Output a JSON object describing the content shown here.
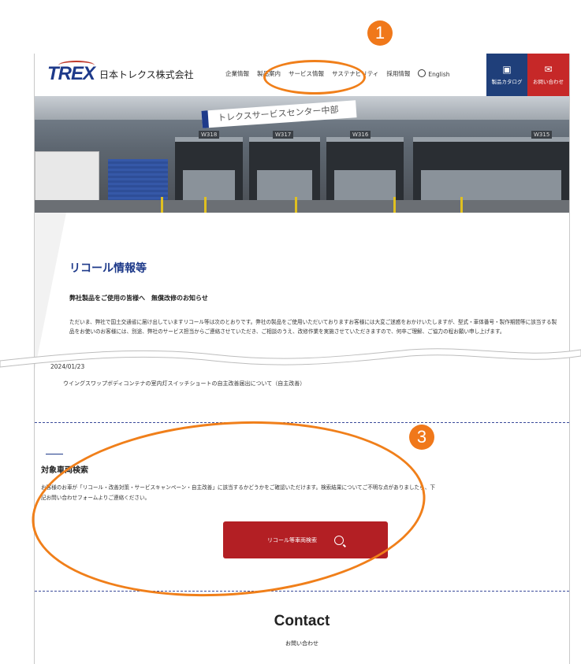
{
  "header": {
    "logo_mark": "TREX",
    "company": "日本トレクス株式会社",
    "nav": [
      "企業情報",
      "製品案内",
      "サービス情報",
      "サステナビリティ",
      "採用情報"
    ],
    "english": "English",
    "catalog_label": "製品カタログ",
    "contact_label": "お問い合わせ"
  },
  "hero": {
    "sign_text": "トレクスサービスセンター中部",
    "bay_labels": [
      "W318",
      "W317",
      "W316",
      "W315"
    ]
  },
  "recall": {
    "title": "リコール情報等",
    "subtitle": "弊社製品をご使用の皆様へ　無償改修のお知らせ",
    "paragraph": "ただいま、弊社で国土交通省に届け出していますリコール等は次のとおりです。弊社の製品をご使用いただいておりますお客様には大変ご迷惑をおかけいたしますが、型式・車体番号・製作期間等に該当する製品をお使いのお客様には、別途、弊社のサービス担当からご連絡させていただき、ご相談のうえ、改修作業を実施させていただきますので、何卒ご理解、ご協力の程お願い申し上げます。",
    "date": "2024/01/23",
    "item": "ウイングスワップボディコンテナの室内灯スイッチショートの自主改善届出について（自主改善）"
  },
  "vehicle_search": {
    "title": "対象車両検索",
    "paragraph": "お客様のお車が「リコール・改善対策・サービスキャンペーン・自主改善」に該当するかどうかをご確認いただけます。検索結果についてご不明な点がありましたら、下記お問い合わせフォームよりご連絡ください。",
    "button_label": "リコール等車両検索"
  },
  "contact": {
    "title": "Contact",
    "subtitle": "お問い合わせ"
  },
  "annotations": {
    "badge_1": "1",
    "badge_3": "3",
    "color": "#f07f1a"
  }
}
